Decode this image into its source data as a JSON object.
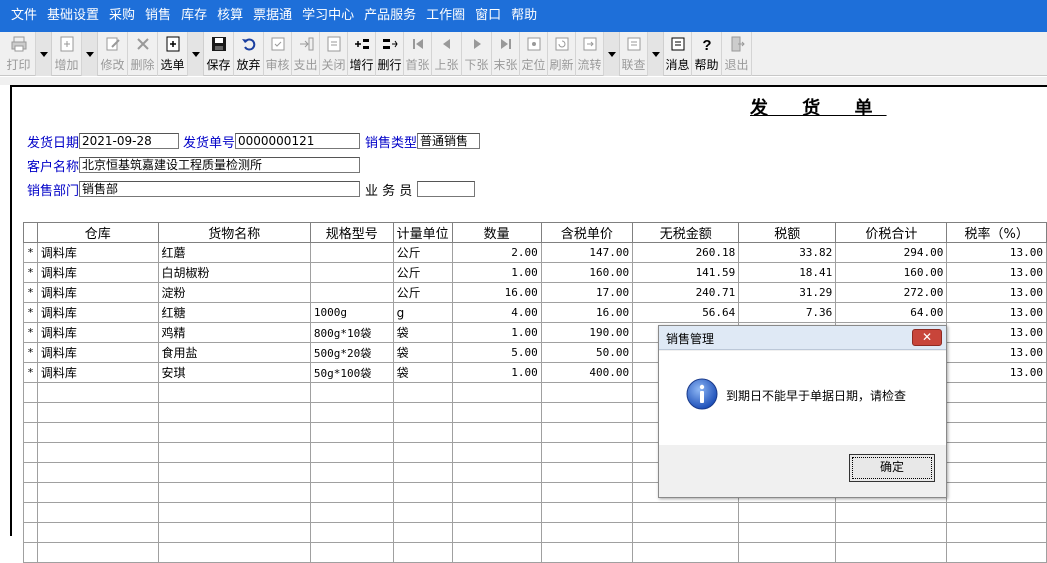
{
  "menu": [
    "文件",
    "基础设置",
    "采购",
    "销售",
    "库存",
    "核算",
    "票据通",
    "学习中心",
    "产品服务",
    "工作圈",
    "窗口",
    "帮助"
  ],
  "toolbar": {
    "print": "打印",
    "add": "增加",
    "edit": "修改",
    "delete": "删除",
    "select": "选单",
    "save": "保存",
    "abandon": "放弃",
    "review": "审核",
    "payment": "支出",
    "close": "关闭",
    "add_row": "增行",
    "delete_row": "删行",
    "first": "首张",
    "prev": "上张",
    "next": "下张",
    "last": "末张",
    "locate": "定位",
    "refresh": "刷新",
    "flow": "流转",
    "link_query": "联查",
    "message": "消息",
    "help": "帮助",
    "exit": "退出"
  },
  "form": {
    "title": "发 货 单",
    "ship_date_label": "发货日期",
    "ship_date": "2021-09-28",
    "ship_no_label": "发货单号",
    "ship_no": "0000000121",
    "sale_type_label": "销售类型",
    "sale_type": "普通销售",
    "customer_label": "客户名称",
    "customer": "北京恒基筑嘉建设工程质量检测所",
    "dept_label": "销售部门",
    "dept": "销售部",
    "salesman_label": "业 务 员",
    "salesman": ""
  },
  "grid": {
    "headers": [
      "仓库",
      "货物名称",
      "规格型号",
      "计量单位",
      "数量",
      "含税单价",
      "无税金额",
      "税额",
      "价税合计",
      "税率（%）"
    ],
    "rows": [
      {
        "mark": "*",
        "warehouse": "调料库",
        "name": "红蘑",
        "spec": "",
        "unit": "公斤",
        "qty": "2.00",
        "price": "147.00",
        "amount": "260.18",
        "tax": "33.82",
        "total": "294.00",
        "rate": "13.00"
      },
      {
        "mark": "*",
        "warehouse": "调料库",
        "name": "白胡椒粉",
        "spec": "",
        "unit": "公斤",
        "qty": "1.00",
        "price": "160.00",
        "amount": "141.59",
        "tax": "18.41",
        "total": "160.00",
        "rate": "13.00"
      },
      {
        "mark": "*",
        "warehouse": "调料库",
        "name": "淀粉",
        "spec": "",
        "unit": "公斤",
        "qty": "16.00",
        "price": "17.00",
        "amount": "240.71",
        "tax": "31.29",
        "total": "272.00",
        "rate": "13.00"
      },
      {
        "mark": "*",
        "warehouse": "调料库",
        "name": "红糖",
        "spec": "1000g",
        "unit": "g",
        "qty": "4.00",
        "price": "16.00",
        "amount": "56.64",
        "tax": "7.36",
        "total": "64.00",
        "rate": "13.00"
      },
      {
        "mark": "*",
        "warehouse": "调料库",
        "name": "鸡精",
        "spec": "800g*10袋",
        "unit": "袋",
        "qty": "1.00",
        "price": "190.00",
        "amount": "",
        "tax": "",
        "total": "",
        "rate": "13.00"
      },
      {
        "mark": "*",
        "warehouse": "调料库",
        "name": "食用盐",
        "spec": "500g*20袋",
        "unit": "袋",
        "qty": "5.00",
        "price": "50.00",
        "amount": "",
        "tax": "",
        "total": "",
        "rate": "13.00"
      },
      {
        "mark": "*",
        "warehouse": "调料库",
        "name": "安琪",
        "spec": "50g*100袋",
        "unit": "袋",
        "qty": "1.00",
        "price": "400.00",
        "amount": "",
        "tax": "",
        "total": "",
        "rate": "13.00"
      }
    ]
  },
  "dialog": {
    "title": "销售管理",
    "close": "✕",
    "message": "到期日不能早于单据日期，请检查",
    "ok": "确定"
  }
}
